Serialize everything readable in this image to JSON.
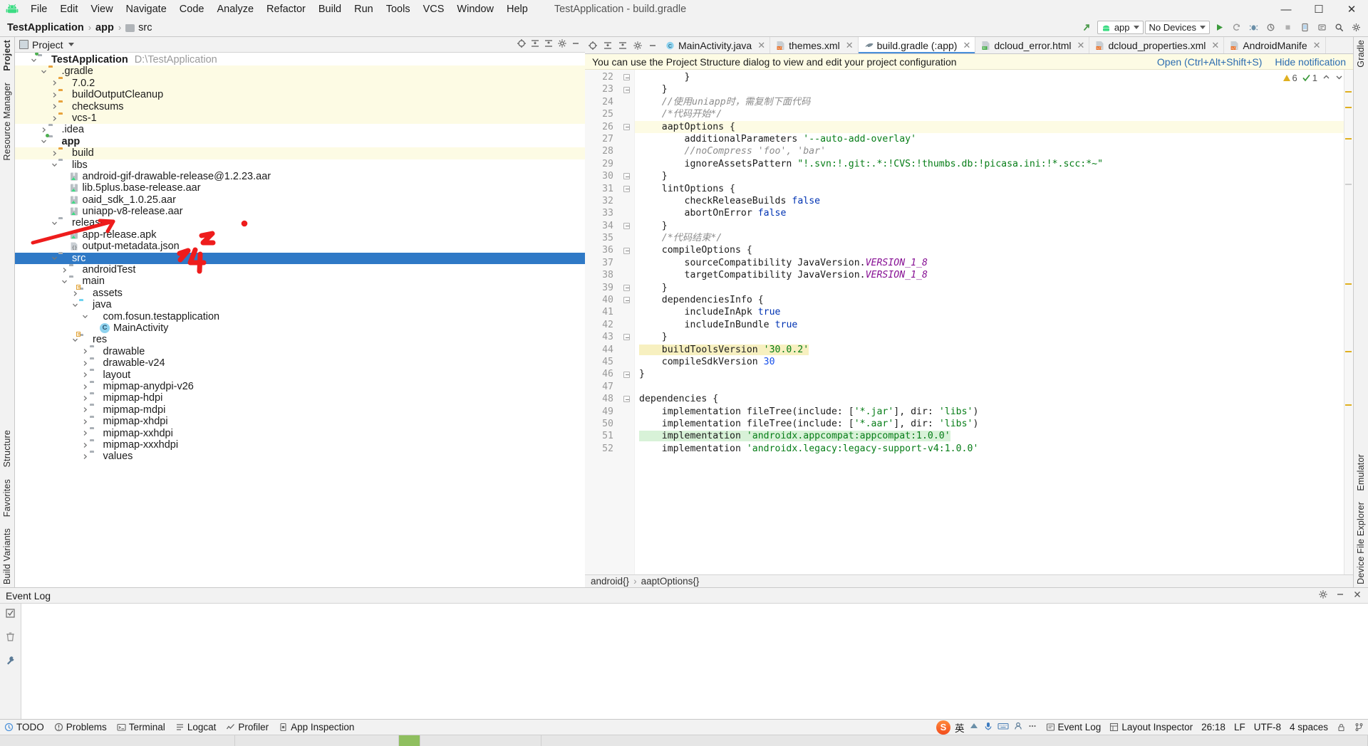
{
  "window": {
    "title": "TestApplication - build.gradle",
    "minimize": "—",
    "maximize": "☐",
    "close": "✕"
  },
  "menu": [
    "File",
    "Edit",
    "View",
    "Navigate",
    "Code",
    "Analyze",
    "Refactor",
    "Build",
    "Run",
    "Tools",
    "VCS",
    "Window",
    "Help"
  ],
  "breadcrumb": {
    "project": "TestApplication",
    "module": "app",
    "folder": "src"
  },
  "toolbar": {
    "run_config": "app",
    "device": "No Devices",
    "run_icon": "run-icon",
    "sync_icon": "sync-gradle-icon",
    "search_icon": "search-everywhere-icon",
    "settings_icon": "settings-icon"
  },
  "project_pane": {
    "title": "Project",
    "tree": [
      {
        "depth": 0,
        "label": "TestApplication",
        "suffix": "D:\\TestApplication",
        "icon": "module-folder",
        "arrow": "down",
        "bold": true,
        "hl": false
      },
      {
        "depth": 1,
        "label": ".gradle",
        "icon": "folder-orange",
        "arrow": "down",
        "hl": true
      },
      {
        "depth": 2,
        "label": "7.0.2",
        "icon": "folder-orange",
        "arrow": "right",
        "hl": true
      },
      {
        "depth": 2,
        "label": "buildOutputCleanup",
        "icon": "folder-orange",
        "arrow": "right",
        "hl": true
      },
      {
        "depth": 2,
        "label": "checksums",
        "icon": "folder-orange",
        "arrow": "right",
        "hl": true
      },
      {
        "depth": 2,
        "label": "vcs-1",
        "icon": "folder-orange",
        "arrow": "right",
        "hl": true
      },
      {
        "depth": 1,
        "label": ".idea",
        "icon": "folder-grey",
        "arrow": "right",
        "hl": false
      },
      {
        "depth": 1,
        "label": "app",
        "icon": "module-folder",
        "arrow": "down",
        "bold": true,
        "hl": false
      },
      {
        "depth": 2,
        "label": "build",
        "icon": "folder-orange",
        "arrow": "right",
        "hl": true
      },
      {
        "depth": 2,
        "label": "libs",
        "icon": "folder-grey",
        "arrow": "down",
        "hl": false
      },
      {
        "depth": 3,
        "label": "android-gif-drawable-release@1.2.23.aar",
        "icon": "archive",
        "arrow": "none",
        "hl": false
      },
      {
        "depth": 3,
        "label": "lib.5plus.base-release.aar",
        "icon": "archive",
        "arrow": "none",
        "hl": false
      },
      {
        "depth": 3,
        "label": "oaid_sdk_1.0.25.aar",
        "icon": "archive",
        "arrow": "none",
        "hl": false
      },
      {
        "depth": 3,
        "label": "uniapp-v8-release.aar",
        "icon": "archive",
        "arrow": "none",
        "hl": false
      },
      {
        "depth": 2,
        "label": "release",
        "icon": "folder-grey",
        "arrow": "down",
        "hl": false
      },
      {
        "depth": 3,
        "label": "app-release.apk",
        "icon": "archive",
        "arrow": "none",
        "hl": false
      },
      {
        "depth": 3,
        "label": "output-metadata.json",
        "icon": "json",
        "arrow": "none",
        "hl": false
      },
      {
        "depth": 2,
        "label": "src",
        "icon": "folder-grey",
        "arrow": "down",
        "selected": true
      },
      {
        "depth": 3,
        "label": "androidTest",
        "icon": "folder-grey",
        "arrow": "right",
        "hl": false
      },
      {
        "depth": 3,
        "label": "main",
        "icon": "folder-grey",
        "arrow": "down",
        "hl": false
      },
      {
        "depth": 4,
        "label": "assets",
        "icon": "folder-res",
        "arrow": "right",
        "hl": false
      },
      {
        "depth": 4,
        "label": "java",
        "icon": "folder-cyan",
        "arrow": "down",
        "hl": false
      },
      {
        "depth": 5,
        "label": "com.fosun.testapplication",
        "icon": "package",
        "arrow": "down",
        "hl": false
      },
      {
        "depth": 6,
        "label": "MainActivity",
        "icon": "class",
        "arrow": "none",
        "hl": false
      },
      {
        "depth": 4,
        "label": "res",
        "icon": "folder-res",
        "arrow": "down",
        "hl": false
      },
      {
        "depth": 5,
        "label": "drawable",
        "icon": "folder-grey",
        "arrow": "right",
        "hl": false
      },
      {
        "depth": 5,
        "label": "drawable-v24",
        "icon": "folder-grey",
        "arrow": "right",
        "hl": false
      },
      {
        "depth": 5,
        "label": "layout",
        "icon": "folder-grey",
        "arrow": "right",
        "hl": false
      },
      {
        "depth": 5,
        "label": "mipmap-anydpi-v26",
        "icon": "folder-grey",
        "arrow": "right",
        "hl": false
      },
      {
        "depth": 5,
        "label": "mipmap-hdpi",
        "icon": "folder-grey",
        "arrow": "right",
        "hl": false
      },
      {
        "depth": 5,
        "label": "mipmap-mdpi",
        "icon": "folder-grey",
        "arrow": "right",
        "hl": false
      },
      {
        "depth": 5,
        "label": "mipmap-xhdpi",
        "icon": "folder-grey",
        "arrow": "right",
        "hl": false
      },
      {
        "depth": 5,
        "label": "mipmap-xxhdpi",
        "icon": "folder-grey",
        "arrow": "right",
        "hl": false
      },
      {
        "depth": 5,
        "label": "mipmap-xxxhdpi",
        "icon": "folder-grey",
        "arrow": "right",
        "hl": false
      },
      {
        "depth": 5,
        "label": "values",
        "icon": "folder-grey",
        "arrow": "right",
        "hl": false
      }
    ]
  },
  "editor": {
    "tabs": [
      {
        "label": "MainActivity.java",
        "icon": "java-class-icon",
        "active": false
      },
      {
        "label": "themes.xml",
        "icon": "xml-icon",
        "active": false
      },
      {
        "label": "build.gradle (:app)",
        "icon": "gradle-icon",
        "active": true
      },
      {
        "label": "dcloud_error.html",
        "icon": "html-icon",
        "active": false
      },
      {
        "label": "dcloud_properties.xml",
        "icon": "xml-icon",
        "active": false
      },
      {
        "label": "AndroidManife",
        "icon": "xml-icon",
        "active": false
      }
    ],
    "notification": {
      "text": "You can use the Project Structure dialog to view and edit your project configuration",
      "open_link": "Open (Ctrl+Alt+Shift+S)",
      "hide_link": "Hide notification"
    },
    "inspection": {
      "warnings": "6",
      "checks": "1"
    },
    "first_line": 22,
    "lines": [
      {
        "n": 22,
        "fold": true,
        "hl": false,
        "tokens": [
          {
            "t": "        }",
            "c": ""
          }
        ]
      },
      {
        "n": 23,
        "fold": true,
        "hl": false,
        "tokens": [
          {
            "t": "    }",
            "c": ""
          }
        ]
      },
      {
        "n": 24,
        "fold": false,
        "hl": false,
        "tokens": [
          {
            "t": "    //使用uniapp时，需复制下面代码",
            "c": "cm"
          }
        ]
      },
      {
        "n": 25,
        "fold": false,
        "hl": false,
        "tokens": [
          {
            "t": "    /*代码开始*/",
            "c": "cm"
          }
        ]
      },
      {
        "n": 26,
        "fold": true,
        "hl": true,
        "tokens": [
          {
            "t": "    aaptOptions {",
            "c": ""
          }
        ]
      },
      {
        "n": 27,
        "fold": false,
        "hl": false,
        "tokens": [
          {
            "t": "        additionalParameters ",
            "c": ""
          },
          {
            "t": "'--auto-add-overlay'",
            "c": "str"
          }
        ]
      },
      {
        "n": 28,
        "fold": false,
        "hl": false,
        "tokens": [
          {
            "t": "        //noCompress 'foo', 'bar'",
            "c": "cm"
          }
        ]
      },
      {
        "n": 29,
        "fold": false,
        "hl": false,
        "tokens": [
          {
            "t": "        ignoreAssetsPattern ",
            "c": ""
          },
          {
            "t": "\"!.svn:!.git:.*:!CVS:!thumbs.db:!picasa.ini:!*.scc:*~\"",
            "c": "str"
          }
        ]
      },
      {
        "n": 30,
        "fold": true,
        "hl": false,
        "tokens": [
          {
            "t": "    }",
            "c": ""
          }
        ]
      },
      {
        "n": 31,
        "fold": true,
        "hl": false,
        "tokens": [
          {
            "t": "    lintOptions {",
            "c": ""
          }
        ]
      },
      {
        "n": 32,
        "fold": false,
        "hl": false,
        "tokens": [
          {
            "t": "        checkReleaseBuilds ",
            "c": ""
          },
          {
            "t": "false",
            "c": "kw"
          }
        ]
      },
      {
        "n": 33,
        "fold": false,
        "hl": false,
        "tokens": [
          {
            "t": "        abortOnError ",
            "c": ""
          },
          {
            "t": "false",
            "c": "kw"
          }
        ]
      },
      {
        "n": 34,
        "fold": true,
        "hl": false,
        "tokens": [
          {
            "t": "    }",
            "c": ""
          }
        ]
      },
      {
        "n": 35,
        "fold": false,
        "hl": false,
        "tokens": [
          {
            "t": "    /*代码结束*/",
            "c": "cm"
          }
        ]
      },
      {
        "n": 36,
        "fold": true,
        "hl": false,
        "tokens": [
          {
            "t": "    compileOptions {",
            "c": ""
          }
        ]
      },
      {
        "n": 37,
        "fold": false,
        "hl": false,
        "tokens": [
          {
            "t": "        sourceCompatibility JavaVersion.",
            "c": ""
          },
          {
            "t": "VERSION_1_8",
            "c": "fld"
          }
        ]
      },
      {
        "n": 38,
        "fold": false,
        "hl": false,
        "tokens": [
          {
            "t": "        targetCompatibility JavaVersion.",
            "c": ""
          },
          {
            "t": "VERSION_1_8",
            "c": "fld"
          }
        ]
      },
      {
        "n": 39,
        "fold": true,
        "hl": false,
        "tokens": [
          {
            "t": "    }",
            "c": ""
          }
        ]
      },
      {
        "n": 40,
        "fold": true,
        "hl": false,
        "tokens": [
          {
            "t": "    dependenciesInfo {",
            "c": ""
          }
        ]
      },
      {
        "n": 41,
        "fold": false,
        "hl": false,
        "tokens": [
          {
            "t": "        includeInApk ",
            "c": ""
          },
          {
            "t": "true",
            "c": "kw"
          }
        ]
      },
      {
        "n": 42,
        "fold": false,
        "hl": false,
        "tokens": [
          {
            "t": "        includeInBundle ",
            "c": ""
          },
          {
            "t": "true",
            "c": "kw"
          }
        ]
      },
      {
        "n": 43,
        "fold": true,
        "hl": false,
        "tokens": [
          {
            "t": "    }",
            "c": ""
          }
        ]
      },
      {
        "n": 44,
        "fold": false,
        "hl": false,
        "mark": "yellow",
        "tokens": [
          {
            "t": "    buildToolsVersion ",
            "c": ""
          },
          {
            "t": "'30.0.2'",
            "c": "str"
          }
        ]
      },
      {
        "n": 45,
        "fold": false,
        "hl": false,
        "tokens": [
          {
            "t": "    compileSdkVersion ",
            "c": ""
          },
          {
            "t": "30",
            "c": "num"
          }
        ]
      },
      {
        "n": 46,
        "fold": true,
        "hl": false,
        "tokens": [
          {
            "t": "}",
            "c": ""
          }
        ]
      },
      {
        "n": 47,
        "fold": false,
        "hl": false,
        "tokens": [
          {
            "t": "",
            "c": ""
          }
        ]
      },
      {
        "n": 48,
        "fold": true,
        "hl": false,
        "tokens": [
          {
            "t": "dependencies {",
            "c": ""
          }
        ]
      },
      {
        "n": 49,
        "fold": false,
        "hl": false,
        "tokens": [
          {
            "t": "    implementation fileTree(include: [",
            "c": ""
          },
          {
            "t": "'*.jar'",
            "c": "str"
          },
          {
            "t": "], dir: ",
            "c": ""
          },
          {
            "t": "'libs'",
            "c": "str"
          },
          {
            "t": ")",
            "c": ""
          }
        ]
      },
      {
        "n": 50,
        "fold": false,
        "hl": false,
        "tokens": [
          {
            "t": "    implementation fileTree(include: [",
            "c": ""
          },
          {
            "t": "'*.aar'",
            "c": "str"
          },
          {
            "t": "], dir: ",
            "c": ""
          },
          {
            "t": "'libs'",
            "c": "str"
          },
          {
            "t": ")",
            "c": ""
          }
        ]
      },
      {
        "n": 51,
        "fold": false,
        "hl": false,
        "mark": "green",
        "tokens": [
          {
            "t": "    implementation ",
            "c": ""
          },
          {
            "t": "'androidx.appcompat:appcompat:1.0.0'",
            "c": "str"
          }
        ]
      },
      {
        "n": 52,
        "fold": false,
        "hl": false,
        "tokens": [
          {
            "t": "    implementation ",
            "c": ""
          },
          {
            "t": "'androidx.legacy:legacy-support-v4:1.0.0'",
            "c": "str"
          }
        ]
      }
    ],
    "breadcrumbs": [
      "android{}",
      "aaptOptions{}"
    ]
  },
  "event_log": {
    "title": "Event Log"
  },
  "left_rail": {
    "top": [
      "Project"
    ],
    "bottom": [
      "Structure",
      "Favorites",
      "Build Variants"
    ],
    "resource_manager": "Resource Manager"
  },
  "right_rail": {
    "top": [
      "Gradle"
    ],
    "bottom": [
      "Emulator",
      "Device File Explorer"
    ]
  },
  "statusbar": {
    "left": [
      {
        "label": "TODO",
        "icon": "todo-icon"
      },
      {
        "label": "Problems",
        "icon": "problems-icon"
      },
      {
        "label": "Terminal",
        "icon": "terminal-icon"
      },
      {
        "label": "Logcat",
        "icon": "logcat-icon"
      },
      {
        "label": "Profiler",
        "icon": "profiler-icon"
      },
      {
        "label": "App Inspection",
        "icon": "app-inspection-icon"
      }
    ],
    "right_tools": [
      {
        "label": "Event Log",
        "icon": "event-log-icon"
      },
      {
        "label": "Layout Inspector",
        "icon": "layout-inspector-icon"
      }
    ],
    "caret": "26:18",
    "line_sep": "LF",
    "encoding": "UTF-8",
    "indent": "4 spaces",
    "lock_icon": "lock-icon",
    "branch_icon": "branch-icon",
    "ime": "英"
  },
  "annotations": {
    "arrow_color": "#ee1c1c",
    "dot_color": "#ee1c1c",
    "marks": [
      "2",
      "3",
      "4"
    ]
  },
  "colors": {
    "accent": "#2f79c6",
    "highlight_row": "#fdfbe4",
    "selection": "#2f79c6",
    "green": "#3c9a3c"
  }
}
